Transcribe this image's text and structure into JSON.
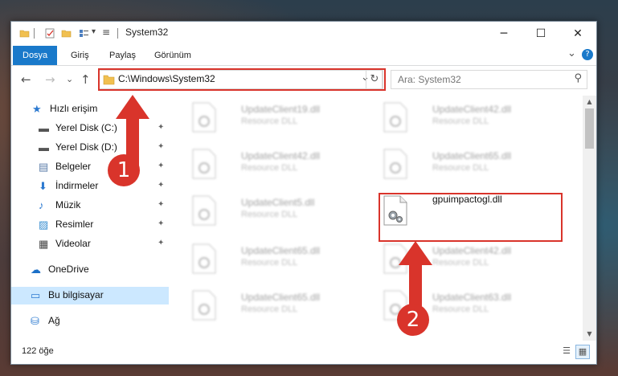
{
  "window": {
    "title": "System32",
    "controls": {
      "minimize": "─",
      "maximize": "☐",
      "close": "✕"
    }
  },
  "ribbon": {
    "tabs": [
      {
        "label": "Dosya",
        "active": true
      },
      {
        "label": "Giriş",
        "active": false
      },
      {
        "label": "Paylaş",
        "active": false
      },
      {
        "label": "Görünüm",
        "active": false
      }
    ],
    "expand_icon": "⌄",
    "help_icon": "?"
  },
  "address": {
    "path": "C:\\Windows\\System32",
    "dropdown": "⌄",
    "refresh": "↻"
  },
  "search": {
    "placeholder": "Ara: System32",
    "icon": "⚲"
  },
  "nav": {
    "back": "←",
    "forward": "→",
    "recent": "⌄",
    "up": "↑"
  },
  "sidebar": {
    "items": [
      {
        "label": "Hızlı erişim",
        "icon": "★",
        "pinned": false
      },
      {
        "label": "Yerel Disk (C:)",
        "icon": "▬",
        "pinned": true
      },
      {
        "label": "Yerel Disk (D:)",
        "icon": "▬",
        "pinned": true
      },
      {
        "label": "Belgeler",
        "icon": "▤",
        "pinned": true
      },
      {
        "label": "İndirmeler",
        "icon": "⬇",
        "pinned": true
      },
      {
        "label": "Müzik",
        "icon": "♪",
        "pinned": true
      },
      {
        "label": "Resimler",
        "icon": "▨",
        "pinned": true
      },
      {
        "label": "Videolar",
        "icon": "▦",
        "pinned": true
      },
      {
        "label": "OneDrive",
        "icon": "☁",
        "pinned": false
      },
      {
        "label": "Bu bilgisayar",
        "icon": "▭",
        "pinned": false,
        "selected": true
      },
      {
        "label": "Ağ",
        "icon": "⛁",
        "pinned": false
      }
    ],
    "pin_icon": "📌"
  },
  "files": [
    {
      "name": "UpdateClient19.dll",
      "type": "Resource DLL",
      "blurred": true
    },
    {
      "name": "UpdateClient42.dll",
      "type": "Resource DLL",
      "blurred": true
    },
    {
      "name": "UpdateClient42.dll",
      "type": "Resource DLL",
      "blurred": true
    },
    {
      "name": "UpdateClient65.dll",
      "type": "Resource DLL",
      "blurred": true
    },
    {
      "name": "UpdateClient5.dll",
      "type": "Resource DLL",
      "blurred": true
    },
    {
      "name": "gpuimpactogl.dll",
      "type": "",
      "blurred": false
    },
    {
      "name": "UpdateClient65.dll",
      "type": "Resource DLL",
      "blurred": true
    },
    {
      "name": "UpdateClient42.dll",
      "type": "Resource DLL",
      "blurred": true
    },
    {
      "name": "UpdateClient65.dll",
      "type": "Resource DLL",
      "blurred": true
    },
    {
      "name": "UpdateClient63.dll",
      "type": "Resource DLL",
      "blurred": true
    }
  ],
  "status": {
    "count_text": "122 öğe"
  },
  "annotations": {
    "step1": "1",
    "step2": "2",
    "color": "#d9342b"
  }
}
